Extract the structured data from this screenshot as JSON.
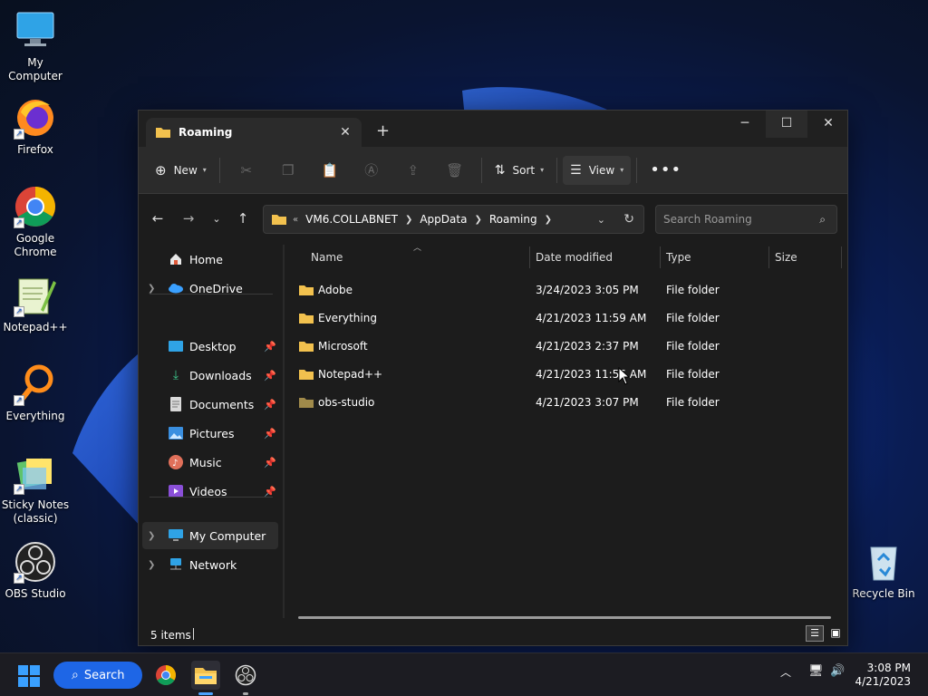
{
  "desktop": {
    "icons": [
      {
        "label": "My Computer"
      },
      {
        "label": "Firefox"
      },
      {
        "label": "Google Chrome"
      },
      {
        "label": "Notepad++"
      },
      {
        "label": "Everything"
      },
      {
        "label": "Sticky Notes (classic)"
      },
      {
        "label": "OBS Studio"
      },
      {
        "label": "Recycle Bin"
      }
    ]
  },
  "window": {
    "tab_title": "Roaming",
    "toolbar": {
      "new_label": "New",
      "sort_label": "Sort",
      "view_label": "View"
    },
    "address": {
      "breadcrumbs": [
        "VM6.COLLABNET",
        "AppData",
        "Roaming"
      ]
    },
    "search": {
      "placeholder": "Search Roaming"
    },
    "nav": {
      "top": [
        {
          "label": "Home"
        },
        {
          "label": "OneDrive"
        }
      ],
      "quick": [
        {
          "label": "Desktop"
        },
        {
          "label": "Downloads"
        },
        {
          "label": "Documents"
        },
        {
          "label": "Pictures"
        },
        {
          "label": "Music"
        },
        {
          "label": "Videos"
        }
      ],
      "devices": [
        {
          "label": "My Computer"
        },
        {
          "label": "Network"
        }
      ]
    },
    "columns": {
      "name": "Name",
      "date": "Date modified",
      "type": "Type",
      "size": "Size"
    },
    "files": [
      {
        "name": "Adobe",
        "date": "3/24/2023 3:05 PM",
        "type": "File folder"
      },
      {
        "name": "Everything",
        "date": "4/21/2023 11:59 AM",
        "type": "File folder"
      },
      {
        "name": "Microsoft",
        "date": "4/21/2023 2:37 PM",
        "type": "File folder"
      },
      {
        "name": "Notepad++",
        "date": "4/21/2023 11:56 AM",
        "type": "File folder"
      },
      {
        "name": "obs-studio",
        "date": "4/21/2023 3:07 PM",
        "type": "File folder"
      }
    ],
    "status": {
      "item_count": "5 items"
    }
  },
  "taskbar": {
    "search_label": "Search",
    "time": "3:08 PM",
    "date": "4/21/2023"
  },
  "colors": {
    "accent": "#1e66e6",
    "folder": "#f2c14e",
    "window_bg": "#1c1c1c"
  }
}
